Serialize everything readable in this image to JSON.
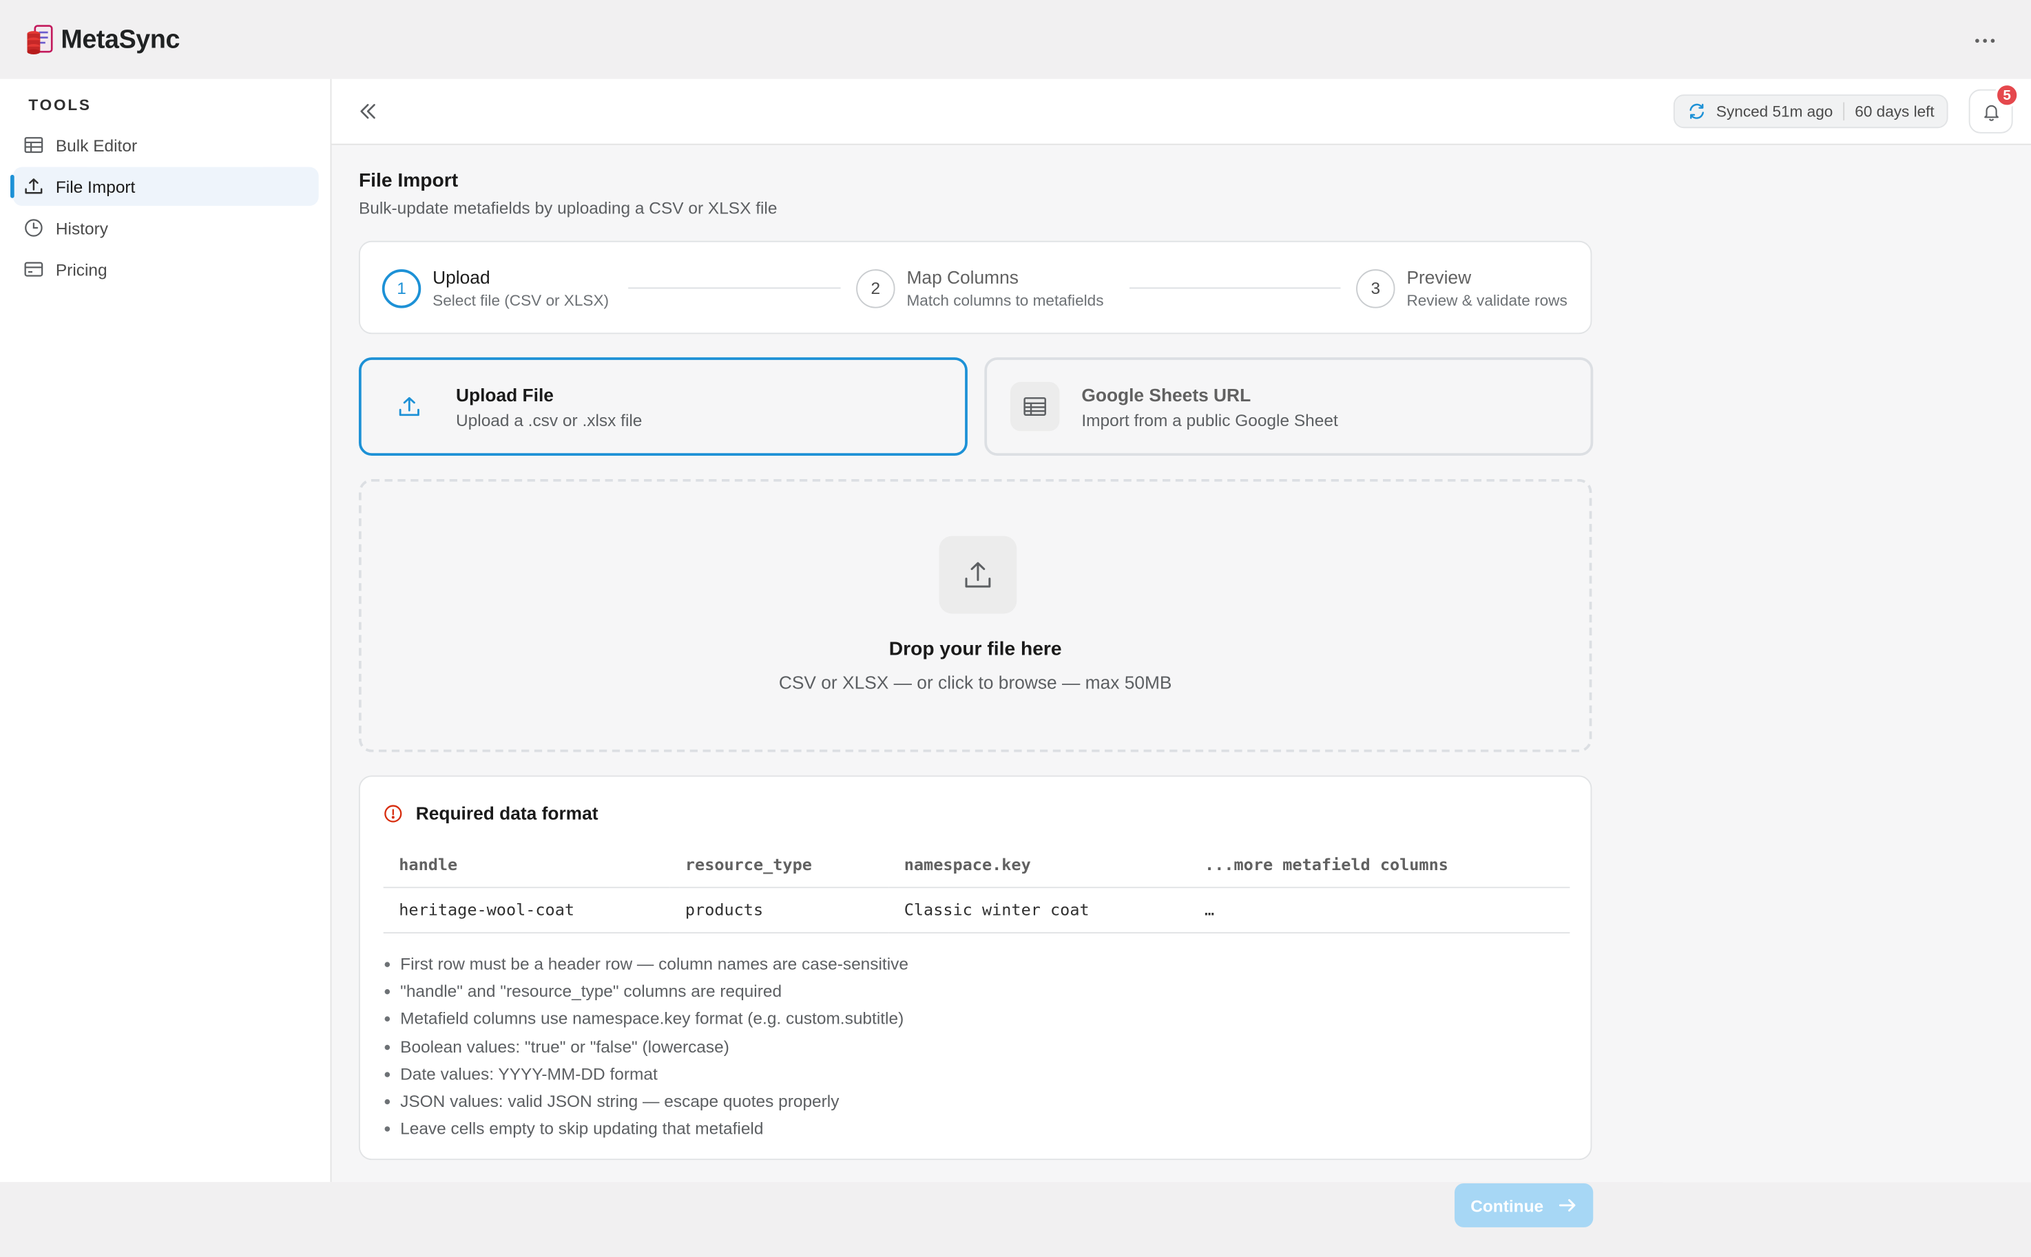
{
  "app": {
    "name": "MetaSync"
  },
  "sidebar": {
    "heading": "TOOLS",
    "items": [
      {
        "label": "Bulk Editor",
        "icon": "table-icon"
      },
      {
        "label": "File Import",
        "icon": "upload-icon",
        "active": true
      },
      {
        "label": "History",
        "icon": "clock-icon"
      },
      {
        "label": "Pricing",
        "icon": "credit-card-icon"
      }
    ]
  },
  "header": {
    "sync_status": "Synced 51m ago",
    "days_left": "60 days left",
    "notification_count": "5"
  },
  "page": {
    "title": "File Import",
    "subtitle": "Bulk-update metafields by uploading a CSV or XLSX file"
  },
  "stepper": [
    {
      "number": "1",
      "title": "Upload",
      "desc": "Select file (CSV or XLSX)",
      "active": true
    },
    {
      "number": "2",
      "title": "Map Columns",
      "desc": "Match columns to metafields"
    },
    {
      "number": "3",
      "title": "Preview",
      "desc": "Review & validate rows"
    }
  ],
  "sources": {
    "upload": {
      "title": "Upload File",
      "desc": "Upload a .csv or .xlsx file",
      "selected": true
    },
    "sheets": {
      "title": "Google Sheets URL",
      "desc": "Import from a public Google Sheet"
    }
  },
  "dropzone": {
    "title": "Drop your file here",
    "subtitle": "CSV or XLSX — or click to browse — max 50MB"
  },
  "format": {
    "title": "Required data format",
    "columns": [
      "handle",
      "resource_type",
      "namespace.key",
      "...more metafield columns"
    ],
    "row": [
      "heritage-wool-coat",
      "products",
      "Classic winter coat",
      "…"
    ],
    "rules": [
      "First row must be a header row — column names are case-sensitive",
      "\"handle\" and \"resource_type\" columns are required",
      "Metafield columns use namespace.key format (e.g. custom.subtitle)",
      "Boolean values: \"true\" or \"false\" (lowercase)",
      "Date values: YYYY-MM-DD format",
      "JSON values: valid JSON string — escape quotes properly",
      "Leave cells empty to skip updating that metafield"
    ]
  },
  "actions": {
    "continue_label": "Continue"
  },
  "colors": {
    "accent": "#1d91d6",
    "accent_disabled": "#a7d7f5",
    "badge": "#e5484d",
    "error_icon": "#d72c0d"
  }
}
